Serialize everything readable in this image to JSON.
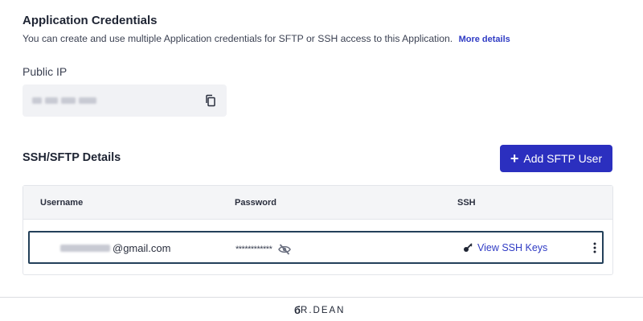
{
  "credentials": {
    "title": "Application Credentials",
    "description": "You can create and use multiple Application credentials for SFTP or SSH access to this Application.",
    "more_link": "More details"
  },
  "public_ip": {
    "label": "Public IP",
    "value_redacted": true,
    "copy_icon": "copy-icon"
  },
  "ssh_sftp": {
    "title": "SSH/SFTP Details",
    "add_button_label": "Add SFTP User",
    "add_icon": "plus-icon",
    "columns": [
      "Username",
      "Password",
      "SSH"
    ],
    "rows": [
      {
        "username_suffix": "@gmail.com",
        "password_masked": "************",
        "password_icon": "eye-off-icon",
        "ssh_link_icon": "key-icon",
        "ssh_link_label": "View SSH Keys",
        "menu_icon": "more-vertical-icon"
      }
    ]
  },
  "footer": {
    "brand_mark": "б",
    "brand_text": "R.DEAN"
  },
  "colors": {
    "accent": "#2b2fbf",
    "link": "#2f3bc4",
    "row_highlight": "#23405a"
  }
}
